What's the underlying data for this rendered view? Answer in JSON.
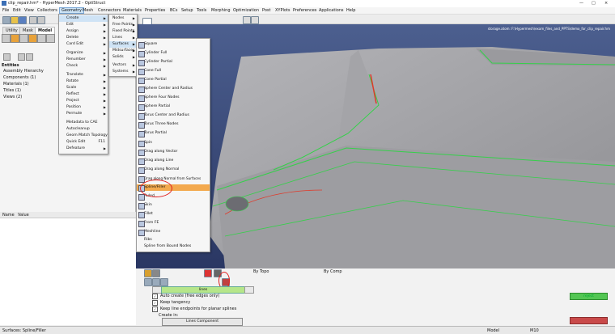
{
  "window": {
    "title": "clip_repair.hm* - HyperMesh 2017.2 - OptiStruct",
    "controls": [
      "—",
      "□",
      "×"
    ]
  },
  "menubar": {
    "items": [
      "File",
      "Edit",
      "View",
      "Collectors",
      "Geometry",
      "Mesh",
      "Connectors",
      "Materials",
      "Properties",
      "BCs",
      "Setup",
      "Tools",
      "Morphing",
      "Optimization",
      "Post",
      "XYPlots",
      "Preferences",
      "Applications",
      "Help"
    ]
  },
  "left_panel": {
    "tabs": [
      "Utility",
      "Mask",
      "Model"
    ],
    "entities_label": "Entities",
    "tree": [
      "Assembly Hierarchy",
      "Components (1)",
      "Materials (1)",
      "Titles (1)",
      "Views (2)"
    ],
    "props_header": {
      "name": "Name",
      "value": "Value"
    }
  },
  "geometry_menu": {
    "items": [
      {
        "label": "Create",
        "arrow": true
      },
      {
        "label": "Edit",
        "arrow": true
      },
      {
        "label": "Assign",
        "arrow": true
      },
      {
        "label": "Delete",
        "arrow": true
      },
      {
        "label": "Card Edit",
        "arrow": true
      },
      {
        "label": "Organize",
        "arrow": true
      },
      {
        "label": "Renumber",
        "arrow": true
      },
      {
        "label": "Check",
        "arrow": true
      },
      {
        "label": "Translate",
        "arrow": true
      },
      {
        "label": "Rotate",
        "arrow": true
      },
      {
        "label": "Scale",
        "arrow": true
      },
      {
        "label": "Reflect",
        "arrow": true
      },
      {
        "label": "Project",
        "arrow": true
      },
      {
        "label": "Position",
        "arrow": true
      },
      {
        "label": "Permute",
        "arrow": true
      },
      {
        "label": "Metadata to CAE",
        "arrow": false
      },
      {
        "label": "Autocleanup",
        "arrow": false
      },
      {
        "label": "Geom Match Topology",
        "arrow": false
      },
      {
        "label": "Quick Edit",
        "shortcut": "F11"
      },
      {
        "label": "Defeature",
        "arrow": true
      }
    ]
  },
  "create_menu": {
    "items": [
      "Nodes",
      "Free Points",
      "Fixed Points",
      "Lines",
      "Surfaces",
      "Midsurfaces",
      "Solids",
      "Vectors",
      "Systems"
    ]
  },
  "surfaces_menu": {
    "items": [
      "Square",
      "Cylinder Full",
      "Cylinder Partial",
      "Cone Full",
      "Cone Partial",
      "Sphere Center and Radius",
      "Sphere Four Nodes",
      "Sphere Partial",
      "Torus Center and Radius",
      "Torus Three Nodes",
      "Torus Partial",
      "Spin",
      "Drag along Vector",
      "Drag along Line",
      "Drag along Normal",
      "Drag along Normal from Surfaces",
      "Spline/Filler",
      "Ruled",
      "Skin",
      "Fillet",
      "From FE",
      "Meshline",
      "Ribs",
      "Spline from Bound Nodes"
    ],
    "highlighted": "Spline/Filler"
  },
  "viewport": {
    "path": "storage.atom: F:\\Hypermesh\\exam_files_and_PPTS\\demo_for_clip_repair.hm"
  },
  "bottom": {
    "by_topo": "By Topo",
    "by_comp": "By Comp",
    "lines_label": "lines",
    "options": [
      {
        "label": "Auto create (free edges only)",
        "checked": true
      },
      {
        "label": "Keep tangency",
        "checked": true
      },
      {
        "label": "Keep line endpoints for planar splines",
        "checked": true
      }
    ],
    "create_in": "Create in:",
    "component_button": "Lines Component",
    "green_button": "reject",
    "red_button": "return"
  },
  "status": {
    "left": "Surfaces: Spline/Filler",
    "model": "Model",
    "id": "M10"
  },
  "colors": {
    "viewport_bg": "#3a4f80",
    "highlight": "#f3a94e",
    "annotation": "#e02020",
    "green_button": "#53c653",
    "red_button": "#c94a4a"
  }
}
